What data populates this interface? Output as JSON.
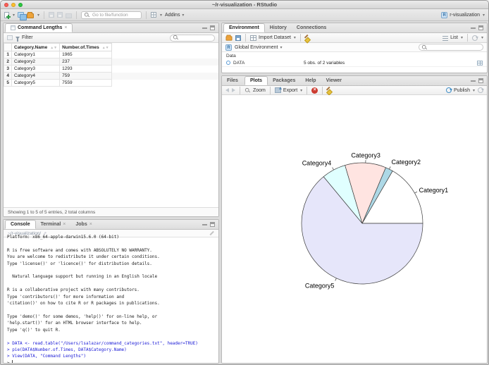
{
  "window": {
    "title": "~/r-visualization - RStudio"
  },
  "main_toolbar": {
    "goto_placeholder": "Go to file/function",
    "addins_label": "Addins",
    "project_label": "r-visualization",
    "icons": [
      "new-document-icon",
      "new-project-icon",
      "open-folder-icon",
      "save-icon",
      "save-all-icon",
      "print-icon",
      "goto-search-icon",
      "pane-layout-icon",
      "r-project-icon"
    ]
  },
  "viewer": {
    "tab_label": "Command Lengths",
    "filter_label": "Filter",
    "search_value": "",
    "table": {
      "columns": [
        "Category.Name",
        "Number.of.Times"
      ],
      "rows": [
        {
          "n": "1",
          "name": "Category1",
          "times": "1965"
        },
        {
          "n": "2",
          "name": "Category2",
          "times": "237"
        },
        {
          "n": "3",
          "name": "Category3",
          "times": "1293"
        },
        {
          "n": "4",
          "name": "Category4",
          "times": "759"
        },
        {
          "n": "5",
          "name": "Category5",
          "times": "7559"
        }
      ]
    },
    "status": "Showing 1 to 5 of 5 entries, 2 total columns"
  },
  "console": {
    "tabs": [
      "Console",
      "Terminal",
      "Jobs"
    ],
    "path": "~/r-visualization/",
    "lines": [
      {
        "kind": "out",
        "text": "Platform: x86_64-apple-darwin15.6.0 (64-bit)"
      },
      {
        "kind": "out",
        "text": ""
      },
      {
        "kind": "out",
        "text": "R is free software and comes with ABSOLUTELY NO WARRANTY."
      },
      {
        "kind": "out",
        "text": "You are welcome to redistribute it under certain conditions."
      },
      {
        "kind": "out",
        "text": "Type 'license()' or 'licence()' for distribution details."
      },
      {
        "kind": "out",
        "text": ""
      },
      {
        "kind": "out",
        "text": "  Natural language support but running in an English locale"
      },
      {
        "kind": "out",
        "text": ""
      },
      {
        "kind": "out",
        "text": "R is a collaborative project with many contributors."
      },
      {
        "kind": "out",
        "text": "Type 'contributors()' for more information and"
      },
      {
        "kind": "out",
        "text": "'citation()' on how to cite R or R packages in publications."
      },
      {
        "kind": "out",
        "text": ""
      },
      {
        "kind": "out",
        "text": "Type 'demo()' for some demos, 'help()' for on-line help, or"
      },
      {
        "kind": "out",
        "text": "'help.start()' for an HTML browser interface to help."
      },
      {
        "kind": "out",
        "text": "Type 'q()' to quit R."
      },
      {
        "kind": "out",
        "text": ""
      },
      {
        "kind": "in",
        "text": "> DATA <- read.table(\"/Users/lsalazar/command_categories.txt\", header=TRUE)"
      },
      {
        "kind": "in",
        "text": "> pie(DATA$Number.of.Times, DATA$Category.Name)"
      },
      {
        "kind": "in",
        "text": "> View(DATA, \"Command Lengths\")"
      },
      {
        "kind": "prompt",
        "text": "> "
      }
    ]
  },
  "environment": {
    "tabs": [
      "Environment",
      "History",
      "Connections"
    ],
    "import_label": "Import Dataset",
    "list_label": "List",
    "scope_label": "Global Environment",
    "search_value": "",
    "section_label": "Data",
    "objects": [
      {
        "name": "DATA",
        "desc": "5 obs. of 2 variables"
      }
    ],
    "icons": [
      "open-folder-icon",
      "save-icon",
      "import-dataset-icon",
      "broom-icon",
      "list-icon",
      "refresh-icon",
      "r-environment-icon",
      "search-icon",
      "view-data-icon"
    ]
  },
  "plots": {
    "tabs": [
      "Files",
      "Plots",
      "Packages",
      "Help",
      "Viewer"
    ],
    "zoom_label": "Zoom",
    "export_label": "Export",
    "publish_label": "Publish",
    "icons": [
      "back-icon",
      "forward-icon",
      "zoom-icon",
      "export-icon",
      "remove-plot-icon",
      "clear-plots-icon",
      "publish-icon",
      "refresh-icon"
    ]
  },
  "chart_data": {
    "type": "pie",
    "title": "",
    "categories": [
      "Category1",
      "Category2",
      "Category3",
      "Category4",
      "Category5"
    ],
    "values": [
      1965,
      237,
      1293,
      759,
      7559
    ],
    "colors": [
      "#FFFFFF",
      "#ADD8E6",
      "#FFE4E1",
      "#E0FFFF",
      "#E6E6FA"
    ],
    "stroke_color": "#3c3c3c",
    "label_color": "#000000",
    "start_angle_deg": 0,
    "direction": "counterclockwise",
    "legend": "none",
    "labels": "category names outside slices with tick marks"
  }
}
